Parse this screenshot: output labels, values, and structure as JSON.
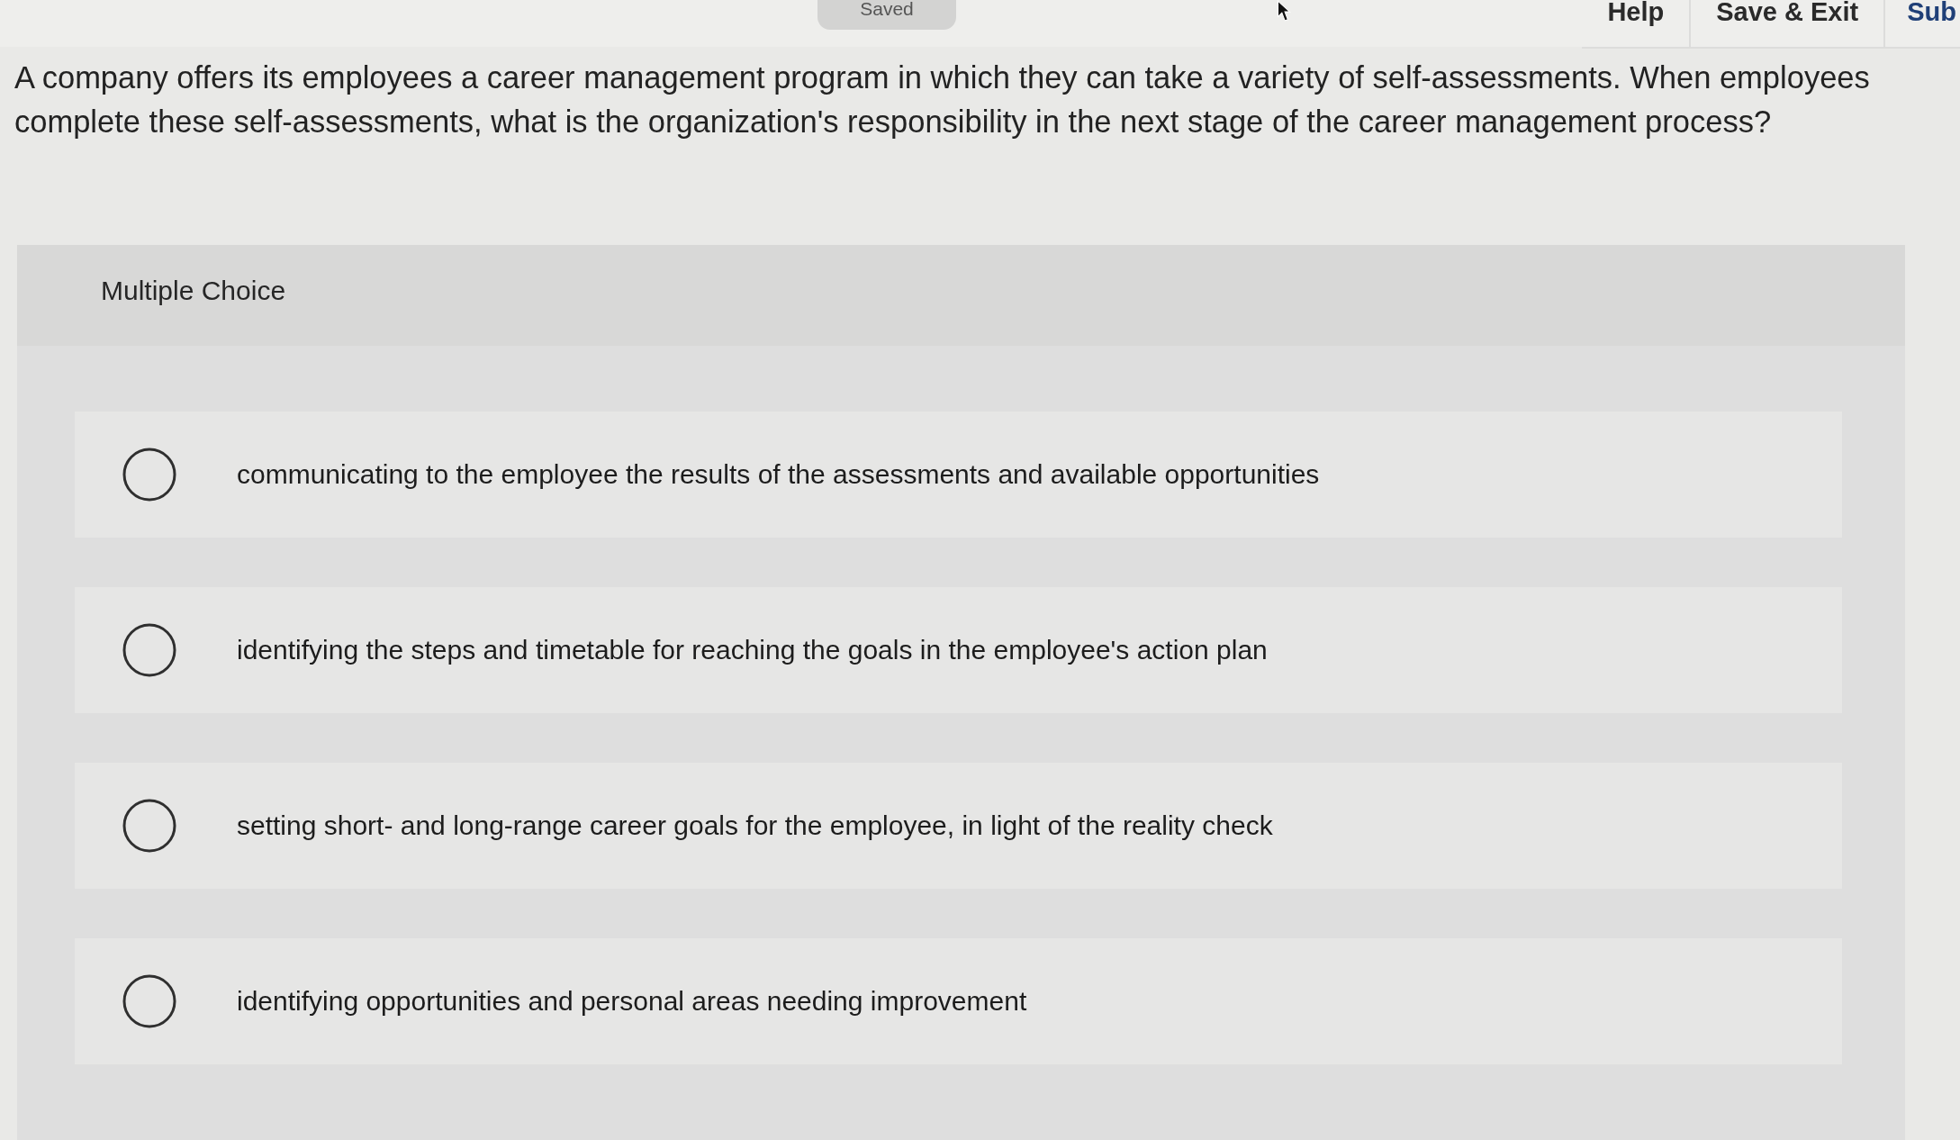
{
  "top_bar": {
    "status": "Saved",
    "links": [
      {
        "label": "Help",
        "kind": "link"
      },
      {
        "label": "Save & Exit",
        "kind": "link"
      },
      {
        "label": "Sub",
        "kind": "primary"
      }
    ]
  },
  "question": "A company offers its employees a career management program in which they can take a variety of self-assessments. When employees complete these self-assessments, what is the organization's responsibility in the next stage of the career management process?",
  "panel": {
    "heading": "Multiple Choice",
    "options": [
      {
        "label": "communicating to the employee the results of the assessments and available opportunities",
        "selected": false
      },
      {
        "label": "identifying the steps and timetable for reaching the goals in the employee's action plan",
        "selected": false
      },
      {
        "label": "setting short- and long-range career goals for the employee, in light of the reality check",
        "selected": false
      },
      {
        "label": "identifying opportunities and personal areas needing improvement",
        "selected": false
      }
    ]
  }
}
